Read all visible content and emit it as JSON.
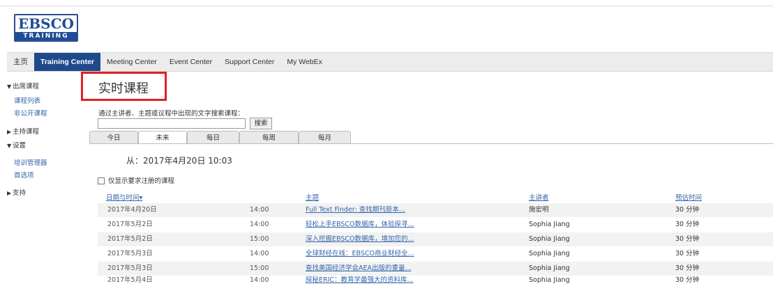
{
  "logo": {
    "main": "EBSCO",
    "sub": "TRAINING"
  },
  "nav": {
    "items": [
      {
        "label": "主页"
      },
      {
        "label": "Training Center"
      },
      {
        "label": "Meeting Center"
      },
      {
        "label": "Event Center"
      },
      {
        "label": "Support Center"
      },
      {
        "label": "My WebEx"
      }
    ],
    "active": "Training Center"
  },
  "sidebar": {
    "attend_heading": "出席课程",
    "attend_items": [
      "课程列表",
      "非公开课程"
    ],
    "host_heading": "主持课程",
    "settings_heading": "设置",
    "settings_items": [
      "培训管理器",
      "首选项"
    ],
    "support_heading": "支持"
  },
  "main": {
    "title": "实时课程",
    "search_hint": "通过主讲者、主题或议程中出现的文字搜索课程：",
    "search_value": "",
    "search_button": "搜索",
    "tabs": [
      "今日",
      "未来",
      "每日",
      "每周",
      "每月"
    ],
    "active_tab": "未来",
    "from_label": "从：2017年4月20日 10:03",
    "registration_filter_label": "仅显示要求注册的课程",
    "registration_filter_checked": false,
    "columns": {
      "datetime": "日期与时间▾",
      "topic": "主题",
      "presenter": "主讲者",
      "duration": "预估时间"
    },
    "rows": [
      {
        "date": "2017年4月20日",
        "time": "14:00",
        "topic": "Full Text Finder: 查找期刊原本...",
        "presenter": "施宏明",
        "duration": "30 分钟"
      },
      {
        "date": "2017年5月2日",
        "time": "14:00",
        "topic": "轻松上手EBSCO数据库，体验探寻...",
        "presenter": "Sophia Jiang",
        "duration": "30 分钟"
      },
      {
        "date": "2017年5月2日",
        "time": "15:00",
        "topic": "深入挖掘EBSCO数据库，增加您的...",
        "presenter": "Sophia Jiang",
        "duration": "30 分钟"
      },
      {
        "date": "2017年5月3日",
        "time": "14:00",
        "topic": "全球财经在线：EBSCO商业财经全...",
        "presenter": "Sophia Jiang",
        "duration": "30 分钟"
      },
      {
        "date": "2017年5月3日",
        "time": "15:00",
        "topic": "查找美国经济学会AEA出版的重量...",
        "presenter": "Sophia Jiang",
        "duration": "30 分钟"
      },
      {
        "date": "2017年5月4日",
        "time": "14:00",
        "topic": "探秘ERIC：教育学最强大的资料库...",
        "presenter": "Sophia Jiang",
        "duration": "30 分钟"
      }
    ]
  },
  "colors": {
    "nav_active": "#1e4a8c",
    "link": "#3366aa",
    "highlight_box": "#e02020"
  }
}
